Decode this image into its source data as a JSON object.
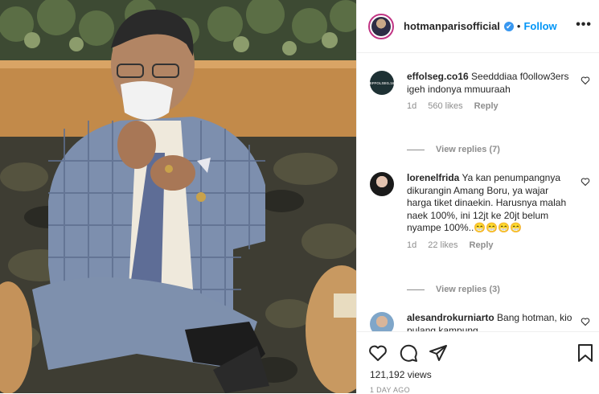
{
  "post": {
    "username": "hotmanparisofficial",
    "verified_mark": "✔",
    "separator": "•",
    "follow_label": "Follow",
    "more_label": "•••"
  },
  "comments": [
    {
      "username": "effolseg.co16",
      "text": "Seedddiaa f0ollow3ers igeh indonya mmuuraah",
      "time": "1d",
      "likes": "560 likes",
      "reply_label": "Reply",
      "view_replies": "View replies (7)",
      "avatar_text": "EFFOLSEG.16"
    },
    {
      "username": "lorenelfrida",
      "text": "Ya kan penumpangnya dikurangin Amang Boru, ya wajar harga tiket dinaekin. Harusnya malah naek 100%, ini 12jt ke 20jt belum nyampe 100%..😁😁😁😁",
      "time": "1d",
      "likes": "22 likes",
      "reply_label": "Reply",
      "view_replies": "View replies (3)"
    },
    {
      "username": "alesandrokurniarto",
      "text": "Bang hotman, kio pulang kampung"
    }
  ],
  "actions": {
    "like_icon": "heart-icon",
    "comment_icon": "comment-icon",
    "share_icon": "share-icon",
    "save_icon": "bookmark-icon"
  },
  "views": "121,192 views",
  "posted_ago": "1 DAY AGO",
  "colors": {
    "follow": "#0095f6",
    "verified": "#3897f0",
    "muted": "#8e8e8e",
    "avatar_ring": "#c13584"
  }
}
